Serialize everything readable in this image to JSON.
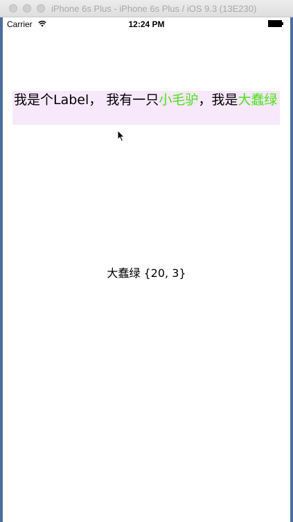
{
  "window": {
    "title": "iPhone 6s Plus - iPhone 6s Plus / iOS 9.3 (13E230)"
  },
  "statusbar": {
    "carrier": "Carrier",
    "time": "12:24 PM"
  },
  "label": {
    "part1": "我是个Label，  我有一只",
    "link1": "小毛驴",
    "part2": "，我是",
    "link2": "大蠢绿",
    "link_color": "#4de01b",
    "background": "#f7e8fb"
  },
  "result": {
    "text": "大蠢绿 {20, 3}"
  }
}
